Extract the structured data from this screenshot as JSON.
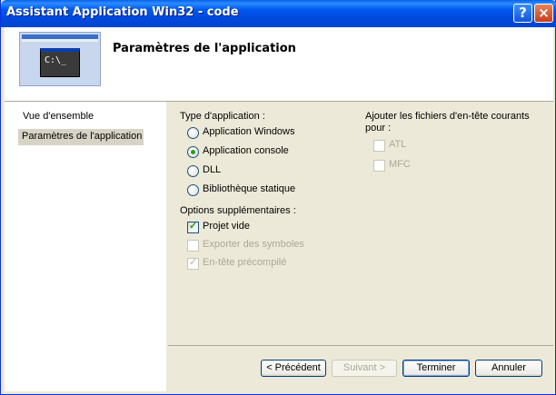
{
  "window": {
    "title": "Assistant Application Win32 - code"
  },
  "titlebar_buttons": {
    "help": "?",
    "close": "×"
  },
  "header": {
    "title": "Paramètres de l'application",
    "console_glyph": "C:\\_"
  },
  "nav": {
    "items": [
      {
        "label": "Vue d'ensemble",
        "selected": false
      },
      {
        "label": "Paramètres de l'application",
        "selected": true
      }
    ]
  },
  "app_type": {
    "label": "Type d'application :",
    "options": [
      {
        "label": "Application Windows",
        "checked": false
      },
      {
        "label": "Application console",
        "checked": true
      },
      {
        "label": "DLL",
        "checked": false
      },
      {
        "label": "Bibliothèque statique",
        "checked": false
      }
    ]
  },
  "extra_options": {
    "label": "Options supplémentaires :",
    "options": [
      {
        "label": "Projet vide",
        "checked": true,
        "enabled": true
      },
      {
        "label": "Exporter des symboles",
        "checked": false,
        "enabled": false
      },
      {
        "label": "En-tête précompilé",
        "checked": true,
        "enabled": false
      }
    ]
  },
  "headers": {
    "label_line1": "Ajouter les fichiers d'en-tête courants",
    "label_line2": "pour :",
    "options": [
      {
        "label": "ATL",
        "checked": false,
        "enabled": false
      },
      {
        "label": "MFC",
        "checked": false,
        "enabled": false
      }
    ]
  },
  "buttons": {
    "previous": "< Précédent",
    "next": "Suivant >",
    "finish": "Terminer",
    "cancel": "Annuler"
  },
  "colors": {
    "titlebar": "#0054e3",
    "selected_nav": "#d7d4c5",
    "radio_dot": "#21a121",
    "disabled_text": "#aca899"
  }
}
